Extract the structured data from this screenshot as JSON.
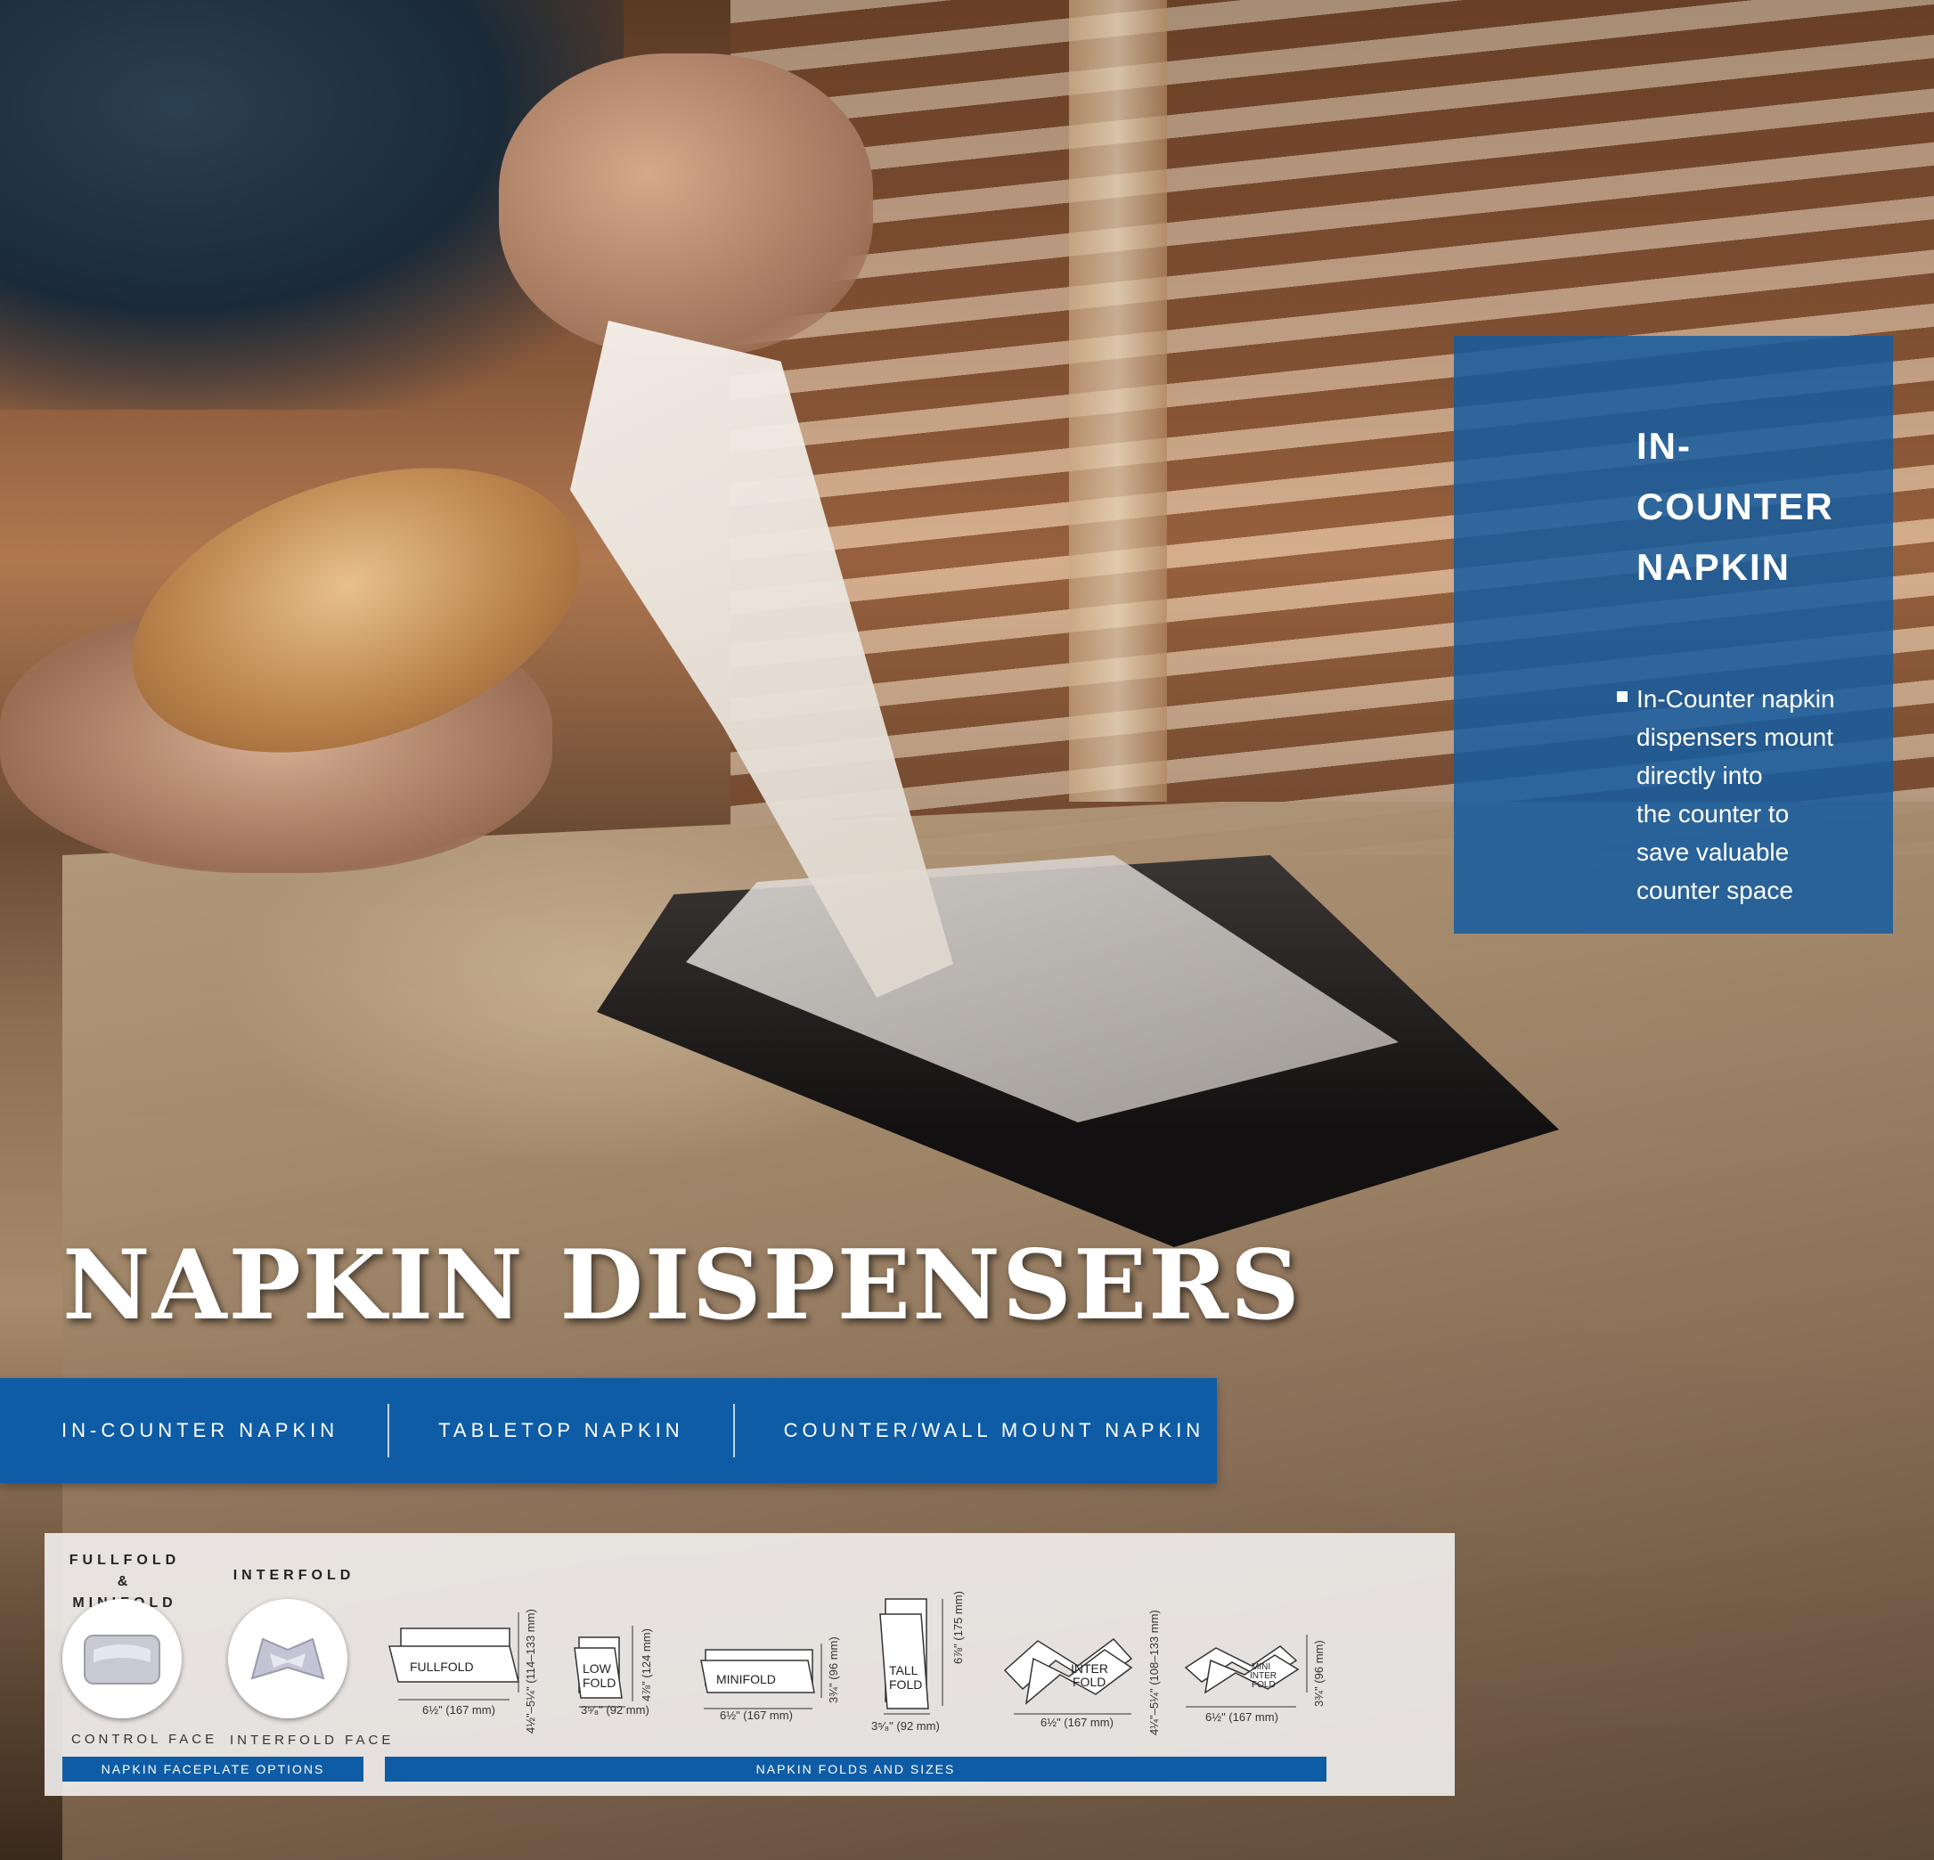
{
  "title": "NAPKIN DISPENSERS",
  "feature": {
    "title_line1": "IN-COUNTER",
    "title_line2": "NAPKIN",
    "bullets": [
      [
        "In-Counter napkin",
        "dispensers mount",
        "directly into",
        "the counter to",
        "save valuable",
        "counter space"
      ]
    ]
  },
  "tabs": [
    "IN-COUNTER NAPKIN",
    "TABLETOP NAPKIN",
    "COUNTER/WALL MOUNT NAPKIN"
  ],
  "faceplates": {
    "bar_label": "NAPKIN FACEPLATE OPTIONS",
    "items": [
      {
        "top_line1": "FULLFOLD &",
        "top_line2": "MINIFOLD",
        "bottom": "CONTROL FACE"
      },
      {
        "top_line1": "INTERFOLD",
        "top_line2": "",
        "bottom": "INTERFOLD FACE"
      }
    ]
  },
  "folds": {
    "bar_label": "NAPKIN FOLDS AND SIZES",
    "items": [
      {
        "label": "FULLFOLD",
        "width": "6½\" (167 mm)",
        "height": "4½\"–5¼\" (114–133 mm)"
      },
      {
        "label_line1": "LOW",
        "label_line2": "FOLD",
        "width": "3⁵⁄₈\" (92 mm)",
        "height": "4⅞\" (124 mm)"
      },
      {
        "label": "MINIFOLD",
        "width": "6½\" (167 mm)",
        "height": "3¾\" (96 mm)"
      },
      {
        "label_line1": "TALL",
        "label_line2": "FOLD",
        "width": "3⁵⁄₈\" (92 mm)",
        "height": "6⅞\" (175 mm)"
      },
      {
        "label_line1": "INTER",
        "label_line2": "FOLD",
        "width": "6½\" (167 mm)",
        "height": "4¼\"–5¼\" (108–133 mm)"
      },
      {
        "label_line1": "MINI",
        "label_line2": "INTER",
        "label_line3": "FOLD",
        "width": "6½\" (167 mm)",
        "height": "3¾\" (96 mm)"
      }
    ]
  }
}
